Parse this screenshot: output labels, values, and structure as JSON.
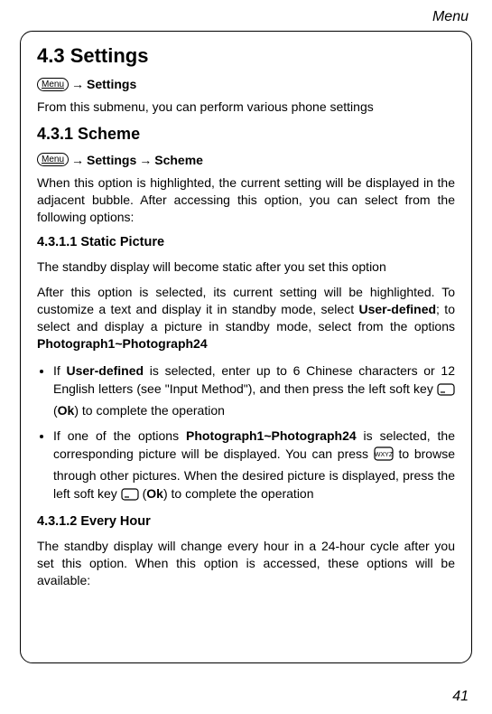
{
  "header": {
    "section": "Menu"
  },
  "page_number": "41",
  "icons": {
    "menu_label": "Menu"
  },
  "h1": "4.3 Settings",
  "nav1": {
    "item1": "Settings"
  },
  "p1": "From this submenu, you can perform various phone settings",
  "h2_1": "4.3.1 Scheme",
  "nav2": {
    "item1": "Settings",
    "item2": "Scheme"
  },
  "p2": "When this option is highlighted, the current setting will be displayed in the adjacent bubble. After accessing this option, you can select from the following options:",
  "h3_1": "4.3.1.1 Static Picture",
  "p3": "The standby display will become static after you set this option",
  "p4_a": "After this option is selected, its current setting will be highlighted. To customize a text and display it in standby mode, select ",
  "p4_bold1": "User-defined",
  "p4_b": "; to select and display a picture in standby mode, select from the options ",
  "p4_bold2": "Photograph1~Photograph24",
  "li1_a": "If ",
  "li1_bold1": "User-defined",
  "li1_b": " is selected, enter up to 6 Chinese characters or 12 English letters (see \"Input Method\"), and then press the left soft key ",
  "li1_c": " (",
  "li1_bold2": "Ok",
  "li1_d": ") to complete the operation",
  "li2_a": "If one of the options ",
  "li2_bold1": "Photograph1~Photograph24",
  "li2_b": " is selected, the corresponding picture will be displayed. You can press ",
  "li2_c": " to browse through other pictures. When the desired picture is displayed, press the left soft key ",
  "li2_d": " (",
  "li2_bold2": "Ok",
  "li2_e": ") to complete the operation",
  "h3_2": "4.3.1.2 Every Hour",
  "p5": "The standby display will change every hour in a 24-hour cycle after you set this option. When this option is accessed, these options will be available:"
}
